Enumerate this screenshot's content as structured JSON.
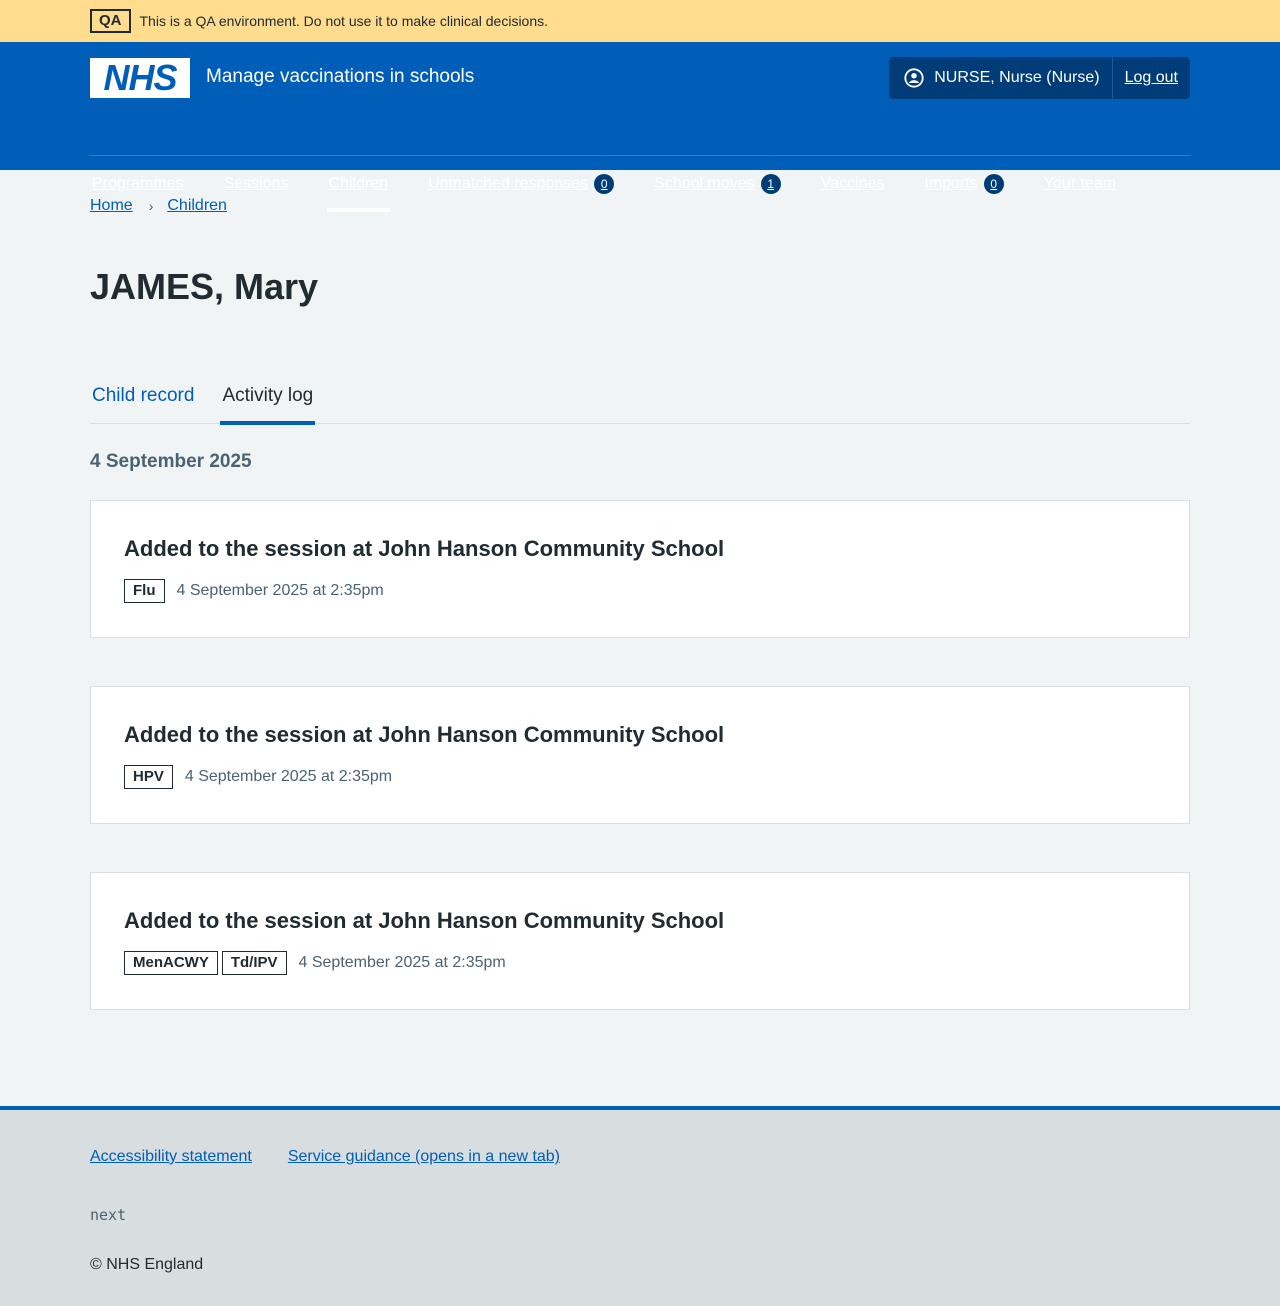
{
  "qa_banner": {
    "tag": "QA",
    "message": "This is a QA environment. Do not use it to make clinical decisions."
  },
  "header": {
    "logo_text": "NHS",
    "service_name": "Manage vaccinations in schools",
    "user": "NURSE, Nurse (Nurse)",
    "logout": "Log out"
  },
  "nav": {
    "programmes": "Programmes",
    "sessions": "Sessions",
    "children": "Children",
    "unmatched": "Unmatched responses",
    "unmatched_count": "0",
    "school_moves": "School moves",
    "school_moves_count": "1",
    "vaccines": "Vaccines",
    "imports": "Imports",
    "imports_count": "0",
    "your_team": "Your team"
  },
  "breadcrumb": {
    "home": "Home",
    "children": "Children",
    "separator": "›"
  },
  "page_title": "JAMES, Mary",
  "tabs": {
    "child_record": "Child record",
    "activity_log": "Activity log"
  },
  "date_heading": "4 September 2025",
  "events": [
    {
      "title": "Added to the session at John Hanson Community School",
      "tags": [
        "Flu"
      ],
      "time": "4 September 2025 at 2:35pm"
    },
    {
      "title": "Added to the session at John Hanson Community School",
      "tags": [
        "HPV"
      ],
      "time": "4 September 2025 at 2:35pm"
    },
    {
      "title": "Added to the session at John Hanson Community School",
      "tags": [
        "MenACWY",
        "Td/IPV"
      ],
      "time": "4 September 2025 at 2:35pm"
    }
  ],
  "footer": {
    "accessibility": "Accessibility statement",
    "guidance": "Service guidance (opens in a new tab)",
    "version": "next",
    "copyright": "© NHS England"
  },
  "colors": {
    "nhs_blue": "#005eb8",
    "qa_yellow": "#ffdc8e",
    "dark_blue": "#003d78",
    "background": "#f0f4f5"
  }
}
